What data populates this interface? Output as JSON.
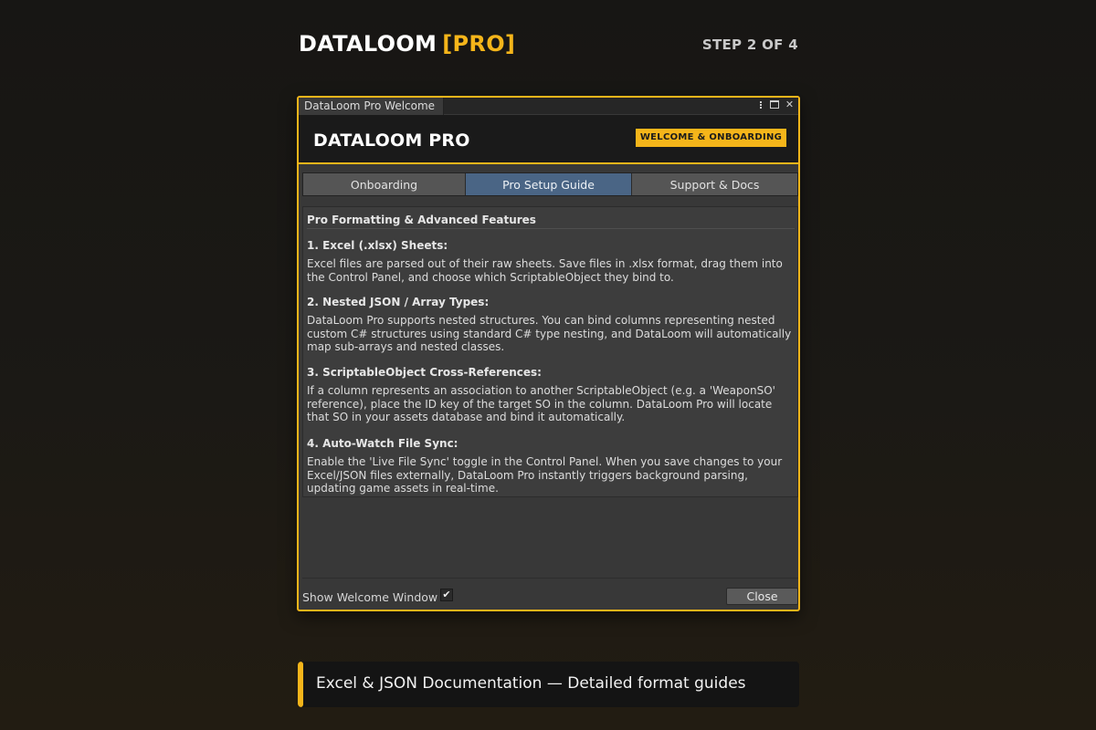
{
  "page": {
    "brand": "DATALOOM",
    "brand_suffix": "[PRO]",
    "step": "STEP 2 OF 4"
  },
  "window": {
    "title": "DataLoom Pro Welcome",
    "header_title": "DATALOOM PRO",
    "header_badge": "WELCOME & ONBOARDING",
    "tabs": [
      {
        "label": "Onboarding",
        "active": false
      },
      {
        "label": "Pro Setup Guide",
        "active": true
      },
      {
        "label": "Support & Docs",
        "active": false
      }
    ],
    "content": {
      "title": "Pro Formatting & Advanced Features",
      "sections": [
        {
          "heading": "1. Excel (.xlsx) Sheets:",
          "body": "Excel files are parsed out of their raw sheets. Save files in .xlsx format, drag them into the Control Panel, and choose which ScriptableObject they bind to."
        },
        {
          "heading": "2. Nested JSON / Array Types:",
          "body": "DataLoom Pro supports nested structures. You can bind columns representing nested custom C# structures using standard C# type nesting, and DataLoom will automatically map sub-arrays and nested classes."
        },
        {
          "heading": "3. ScriptableObject Cross-References:",
          "body": "If a column represents an association to another ScriptableObject (e.g. a 'WeaponSO' reference), place the ID key of the target SO in the column. DataLoom Pro will locate that SO in your assets database and bind it automatically."
        },
        {
          "heading": "4. Auto-Watch File Sync:",
          "body": "Enable the 'Live File Sync' toggle in the Control Panel. When you save changes to your Excel/JSON files externally, DataLoom Pro instantly triggers background parsing, updating game assets in real-time."
        }
      ]
    },
    "footer": {
      "show_label": "Show Welcome Window o",
      "checkbox_checked": true,
      "close_label": "Close"
    }
  },
  "callout": {
    "text": "Excel & JSON Documentation — Detailed format guides"
  },
  "colors": {
    "accent": "#f5b51a",
    "active_tab": "#4a6585",
    "panel_bg": "#383838"
  },
  "icons": {
    "menu": "kebab-menu-icon",
    "maximize": "maximize-icon",
    "close": "close-icon",
    "check": "checkmark-icon"
  }
}
